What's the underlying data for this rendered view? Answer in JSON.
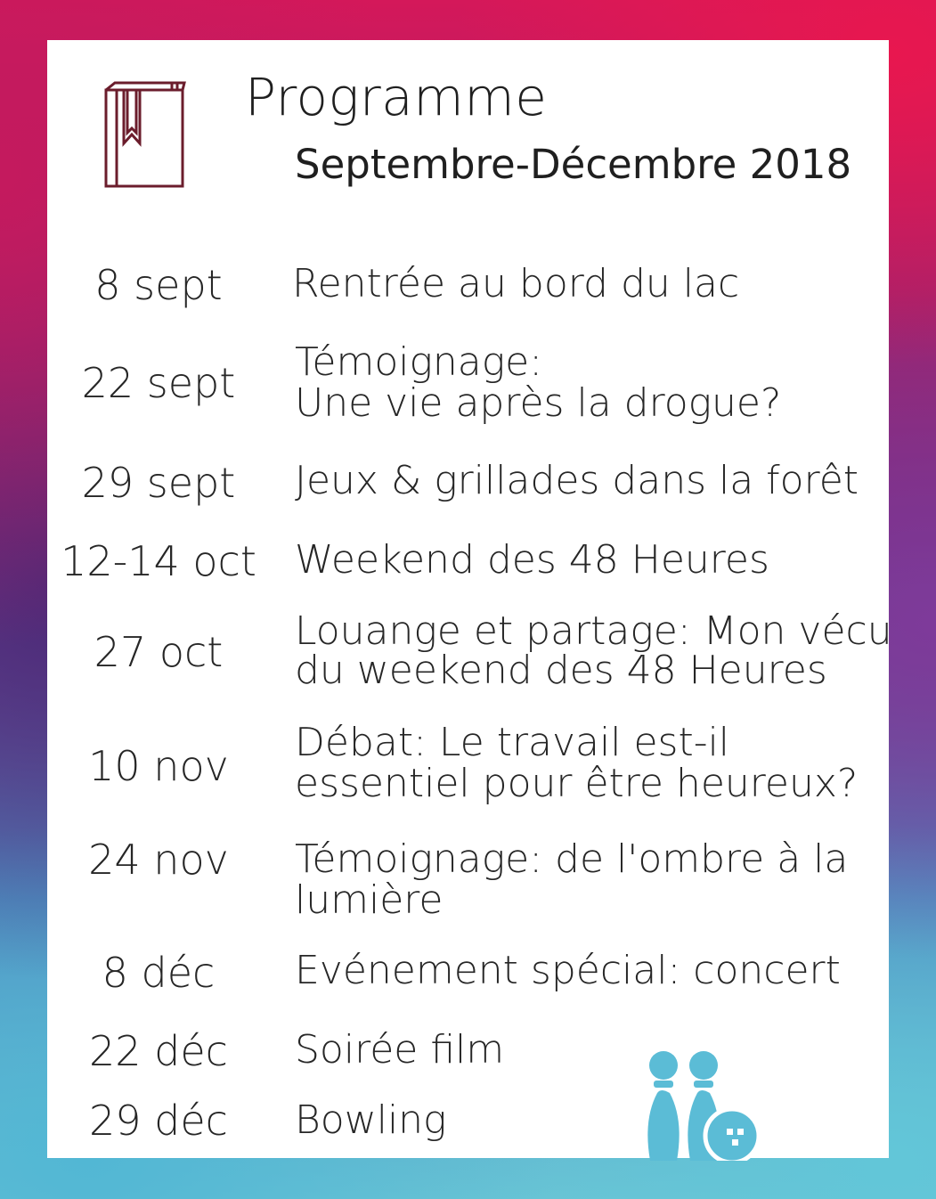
{
  "header": {
    "title": "Programme",
    "subtitle": "Septembre-Décembre 2018",
    "icon": "book-bookmark-icon"
  },
  "schedule": [
    {
      "date": "8 sept",
      "event": [
        "Rentrée au bord du lac"
      ]
    },
    {
      "date": "22 sept",
      "event": [
        "Témoignage:",
        "Une vie après la drogue?"
      ]
    },
    {
      "date": "29 sept",
      "event": [
        "Jeux & grillades dans la forêt"
      ]
    },
    {
      "date": "12-14 oct",
      "event": [
        "Weekend des 48 Heures"
      ]
    },
    {
      "date": "27 oct",
      "event": [
        "Louange et partage: Mon vécu",
        "du weekend des 48 Heures"
      ]
    },
    {
      "date": "10 nov",
      "event": [
        "Débat: Le travail est-il",
        "essentiel pour être heureux?"
      ]
    },
    {
      "date": "24 nov",
      "event": [
        "Témoignage: de l'ombre à la",
        "lumière"
      ]
    },
    {
      "date": "8 déc",
      "event": [
        "Evénement spécial: concert"
      ]
    },
    {
      "date": "22 déc",
      "event": [
        "Soirée film"
      ]
    },
    {
      "date": "29 déc",
      "event": [
        "Bowling"
      ]
    }
  ],
  "decoration": {
    "icon": "bowling-pins-icon",
    "colors": {
      "icon_book": "#6b1d2c",
      "icon_pins": "#5bbcd6",
      "card": "#ffffff",
      "text": "#262626"
    }
  }
}
